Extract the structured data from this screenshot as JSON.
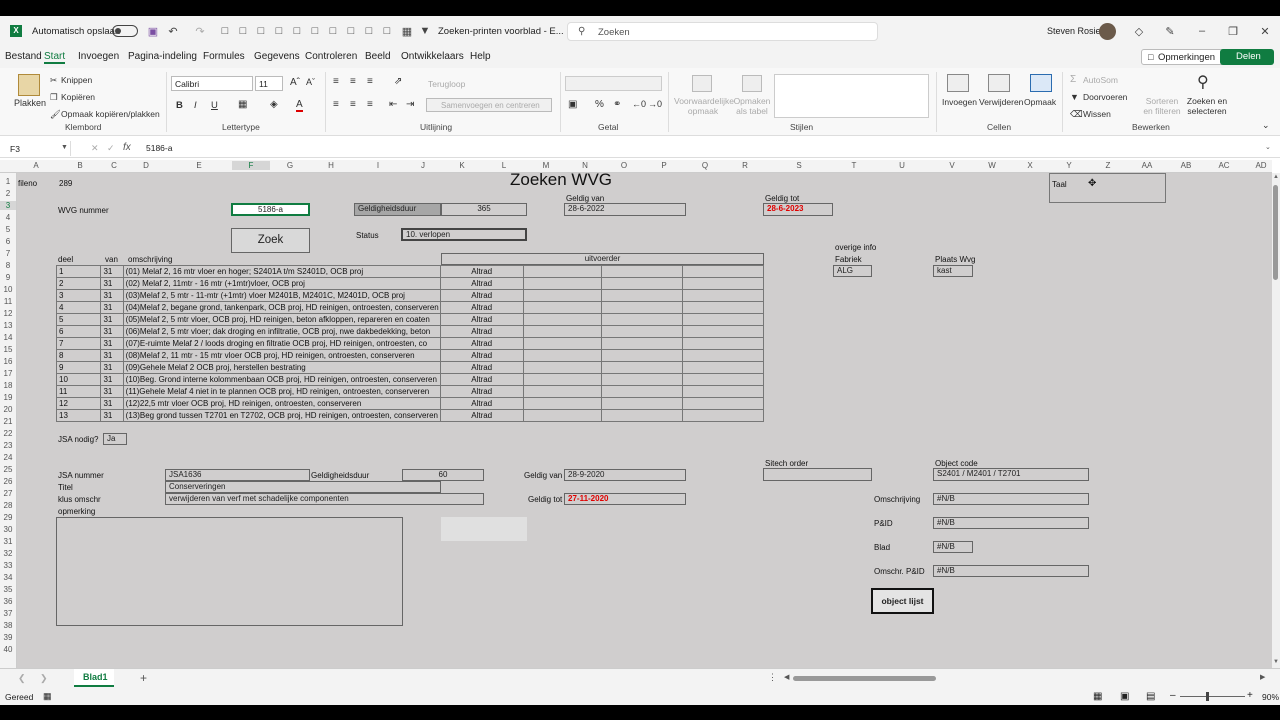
{
  "titlebar": {
    "autosave": "Automatisch opslaan",
    "filename": "Zoeken-printen voorblad - E...",
    "search_placeholder": "Zoeken",
    "user": "Steven Rosier"
  },
  "menu": [
    "Bestand",
    "Start",
    "Invoegen",
    "Pagina-indeling",
    "Formules",
    "Gegevens",
    "Controleren",
    "Beeld",
    "Ontwikkelaars",
    "Help"
  ],
  "menu_right": {
    "comments": "Opmerkingen",
    "share": "Delen"
  },
  "ribbon": {
    "clipboard": {
      "paste": "Plakken",
      "cut": "Knippen",
      "copy": "Kopiëren",
      "format_painter": "Opmaak kopiëren/plakken",
      "label": "Klembord"
    },
    "font": {
      "name": "Calibri",
      "size": "11",
      "label": "Lettertype"
    },
    "alignment": {
      "wrap": "Terugloop",
      "merge": "Samenvoegen en centreren",
      "label": "Uitlijning"
    },
    "number": {
      "label": "Getal"
    },
    "styles": {
      "conditional": "Voorwaardelijke opmaak",
      "table": "Opmaken als tabel",
      "label": "Stijlen"
    },
    "cells": {
      "insert": "Invoegen",
      "delete": "Verwijderen",
      "format": "Opmaak",
      "label": "Cellen"
    },
    "editing": {
      "autosum": "AutoSom",
      "fill": "Doorvoeren",
      "clear": "Wissen",
      "sort": "Sorteren en filteren",
      "find": "Zoeken en selecteren",
      "label": "Bewerken"
    }
  },
  "formula": {
    "namebox": "F3",
    "value": "5186-a"
  },
  "columns": [
    "A",
    "B",
    "C",
    "D",
    "E",
    "F",
    "G",
    "H",
    "I",
    "J",
    "K",
    "L",
    "M",
    "N",
    "O",
    "P",
    "Q",
    "R",
    "S",
    "T",
    "U",
    "V",
    "W",
    "X",
    "Y",
    "Z",
    "AA",
    "AB",
    "AC",
    "AD"
  ],
  "sheet": {
    "fileno_label": "fileno",
    "fileno": "289",
    "title": "Zoeken WVG",
    "taal": "Taal",
    "wvg_label": "WVG nummer",
    "wvg_value": "5186-a",
    "geldigheidsduur_label": "Geldigheidsduur",
    "geldigheidsduur": "365",
    "geldig_van_label": "Geldig van",
    "geldig_van": "28-6-2022",
    "geldig_tot_label": "Geldig tot",
    "geldig_tot": "28-6-2023",
    "zoek_button": "Zoek",
    "status_label": "Status",
    "status": "10. verlopen",
    "overige_info": "overige info",
    "fabriek_label": "Fabriek",
    "fabriek": "ALG",
    "plaats_label": "Plaats Wvg",
    "plaats": "kast",
    "table_headers": {
      "deel": "deel",
      "van": "van",
      "omschrijving": "omschrijving",
      "uitvoerder": "uitvoerder"
    },
    "rows": [
      {
        "deel": "1",
        "van": "31",
        "omschrijving": "(01) Melaf 2, 16 mtr vloer en hoger; S2401A t/m S2401D, OCB proj",
        "uitvoerder": "Altrad"
      },
      {
        "deel": "2",
        "van": "31",
        "omschrijving": "(02) Melaf 2, 11mtr - 16 mtr (+1mtr)vloer, OCB proj",
        "uitvoerder": "Altrad"
      },
      {
        "deel": "3",
        "van": "31",
        "omschrijving": "(03)Melaf 2, 5 mtr - 11-mtr (+1mtr) vloer M2401B, M2401C, M2401D, OCB proj",
        "uitvoerder": "Altrad"
      },
      {
        "deel": "4",
        "van": "31",
        "omschrijving": "(04)Melaf 2, begane grond, tankenpark, OCB proj, HD reinigen, ontroesten, conserveren",
        "uitvoerder": "Altrad"
      },
      {
        "deel": "5",
        "van": "31",
        "omschrijving": "(05)Melaf 2, 5 mtr vloer, OCB proj, HD reinigen, beton afkloppen, repareren en coaten",
        "uitvoerder": "Altrad"
      },
      {
        "deel": "6",
        "van": "31",
        "omschrijving": "(06)Melaf 2, 5 mtr vloer; dak droging en infiltratie, OCB proj, nwe dakbedekking, beton",
        "uitvoerder": "Altrad"
      },
      {
        "deel": "7",
        "van": "31",
        "omschrijving": "(07)E-ruimte Melaf 2 / loods droging en filtratie OCB proj, HD reinigen, ontroesten, co",
        "uitvoerder": "Altrad"
      },
      {
        "deel": "8",
        "van": "31",
        "omschrijving": "(08)Melaf 2, 11 mtr - 15 mtr vloer OCB proj, HD reinigen, ontroesten, conserveren",
        "uitvoerder": "Altrad"
      },
      {
        "deel": "9",
        "van": "31",
        "omschrijving": "(09)Gehele Melaf 2 OCB proj, herstellen bestrating",
        "uitvoerder": "Altrad"
      },
      {
        "deel": "10",
        "van": "31",
        "omschrijving": "(10)Beg. Grond interne kolommenbaan OCB proj, HD reinigen, ontroesten, conserveren",
        "uitvoerder": "Altrad"
      },
      {
        "deel": "11",
        "van": "31",
        "omschrijving": "(11)Gehele Melaf 4 niet in te plannen OCB proj, HD reinigen, ontroesten, conserveren",
        "uitvoerder": "Altrad"
      },
      {
        "deel": "12",
        "van": "31",
        "omschrijving": "(12)22,5 mtr vloer OCB proj, HD reinigen, ontroesten, conserveren",
        "uitvoerder": "Altrad"
      },
      {
        "deel": "13",
        "van": "31",
        "omschrijving": "(13)Beg grond tussen T2701 en T2702, OCB proj, HD reinigen, ontroesten, conserveren",
        "uitvoerder": "Altrad"
      }
    ],
    "jsa_nodig_label": "JSA nodig?",
    "jsa_nodig": "Ja",
    "jsa_nummer_label": "JSA nummer",
    "jsa_nummer": "JSA1636",
    "jsa_duur_label": "Geldigheidsduur",
    "jsa_duur": "60",
    "jsa_van_label": "Geldig van",
    "jsa_van": "28-9-2020",
    "jsa_tot_label": "Geldig tot",
    "jsa_tot": "27-11-2020",
    "titel_label": "Titel",
    "titel": "Conserveringen",
    "klus_label": "klus omschr",
    "klus": "verwijderen van verf met schadelijke componenten",
    "opmerking_label": "opmerking",
    "sitech_label": "Sitech order",
    "object_code_label": "Object code",
    "object_code": "S2401 / M2401 / T2701",
    "omschrijving_label": "Omschrijving",
    "omschrijving_val": "#N/B",
    "pid_label": "P&ID",
    "pid_val": "#N/B",
    "blad_label": "Blad",
    "blad_val": "#N/B",
    "omschr_pid_label": "Omschr. P&ID",
    "omschr_pid_val": "#N/B",
    "object_lijst_button": "object lijst"
  },
  "sheet_tab": "Blad1",
  "status": {
    "ready": "Gereed",
    "zoom": "90%"
  },
  "colors": {
    "red_date": "#e00000",
    "excel_green": "#107c41"
  }
}
